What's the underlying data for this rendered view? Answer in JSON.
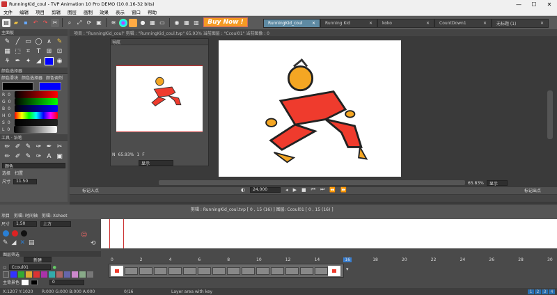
{
  "window": {
    "title": "RunningKid_coul - TVP Animation 10 Pro DEMO (10.0.16-32 bits)"
  },
  "menu": [
    "文件",
    "编辑",
    "项目",
    "剪辑",
    "图层",
    "画制",
    "效果",
    "表示",
    "窗口",
    "帮助"
  ],
  "buy_now": "Buy Now !",
  "tabs": [
    {
      "label": "RunningKid_coul"
    },
    {
      "label": "Running Kid"
    },
    {
      "label": "koko"
    },
    {
      "label": "CountDown1"
    },
    {
      "label": "无标题 (1)"
    }
  ],
  "info_line": "项目 : \"RunningKid_coul\"   剪辑 : \"RunningKid_coul.tvp\"  65.93%   当前图层 : \"Ccoul01\"   当前图像 : 0",
  "left": {
    "main_panel": "主面板",
    "color_picker": "颜色选择器",
    "color_tabs": [
      "颜色滑块",
      "颜色选择器",
      "颜色调剂"
    ],
    "sliders": [
      "R",
      "G",
      "B",
      "H",
      "S",
      "L"
    ],
    "slider_values": [
      "0",
      "0",
      "0",
      "0",
      "0",
      "0"
    ],
    "tools": "工具 · 铅笔",
    "color_label": "颜色",
    "opt_tabs": [
      "选择",
      "扫置"
    ],
    "size_label": "尺寸",
    "size_value": "11.50"
  },
  "nav": {
    "title": "导航",
    "zoom": "65.93%",
    "frame": "1",
    "mode": "显示",
    "flag": "F",
    "n": "N"
  },
  "viewer": {
    "zoom": "65.83%",
    "fps": "24.000",
    "mark_in": "标记入点",
    "mark_out": "标记出点",
    "show": "显示"
  },
  "clip_info": "剪辑 : RunningKid_coul.tvp [ 0 , 15 (16) ]    图层: Ccoul01 [ 0 , 15 (16) ]",
  "timeline": {
    "tabs": [
      "项目",
      "剪辑: 时间轴",
      "剪辑: Xsheet"
    ],
    "size_label": "尺寸",
    "size_value": "1.50",
    "direction": "上方",
    "new_btn": "新建",
    "layer_name": "Ccoul01",
    "main_bg": "主背景色",
    "bg_value": "0",
    "ruler": [
      "0",
      "2",
      "4",
      "6",
      "8",
      "10",
      "12",
      "14",
      "16",
      "18",
      "20",
      "22",
      "24",
      "26",
      "28",
      "30"
    ],
    "marker16": "16",
    "layer_filter": "图层筛选"
  },
  "status": {
    "coords": "X:1207  Y:1020",
    "rgb": "R:000 G:000 B:000 A:000",
    "frames": "0/16",
    "hint": "Layer area with key",
    "pages": [
      "1",
      "2",
      "3",
      "4"
    ]
  }
}
